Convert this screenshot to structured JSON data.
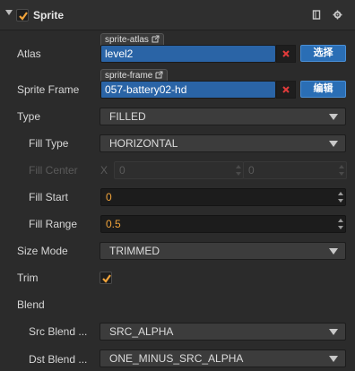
{
  "header": {
    "title": "Sprite",
    "enabled": true,
    "icons": [
      "book-icon",
      "gear-icon"
    ]
  },
  "atlas": {
    "label": "Atlas",
    "tag": "sprite-atlas",
    "value": "level2",
    "button": "选择"
  },
  "sprite_frame": {
    "label": "Sprite Frame",
    "tag": "sprite-frame",
    "value": "057-battery02-hd",
    "button": "编辑"
  },
  "type": {
    "label": "Type",
    "value": "FILLED"
  },
  "fill_type": {
    "label": "Fill Type",
    "value": "HORIZONTAL"
  },
  "fill_center": {
    "label": "Fill Center",
    "x_label": "X",
    "x_value": "0",
    "y_label": "Y",
    "y_value": "0"
  },
  "fill_start": {
    "label": "Fill Start",
    "value": "0"
  },
  "fill_range": {
    "label": "Fill Range",
    "value": "0.5"
  },
  "size_mode": {
    "label": "Size Mode",
    "value": "TRIMMED"
  },
  "trim": {
    "label": "Trim",
    "checked": true
  },
  "blend": {
    "label": "Blend"
  },
  "src_blend": {
    "label": "Src Blend ...",
    "value": "SRC_ALPHA"
  },
  "dst_blend": {
    "label": "Dst Blend ...",
    "value": "ONE_MINUS_SRC_ALPHA"
  },
  "colors": {
    "accent_orange": "#f0a33a",
    "asset_blue": "#2a64a6",
    "button_blue": "#2a6eb5",
    "clear_red": "#e23b3b"
  }
}
